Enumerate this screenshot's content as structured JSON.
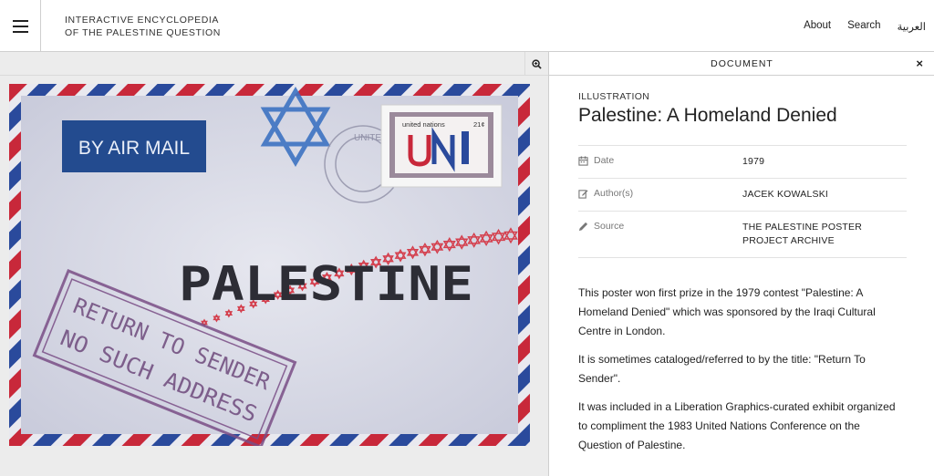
{
  "header": {
    "site_title_line1": "INTERACTIVE ENCYCLOPEDIA",
    "site_title_line2": "OF THE PALESTINE QUESTION",
    "nav": {
      "about": "About",
      "search": "Search",
      "arabic": "العربية"
    }
  },
  "viewer": {
    "zoom_icon": "zoom-in-icon",
    "poster": {
      "airmail_label": "BY AIR MAIL",
      "stamp_text": "united nations",
      "stamp_value": "21¢",
      "stamp_letters": "UN",
      "main_word": "PALESTINE",
      "stamp_line1": "RETURN TO SENDER",
      "stamp_line2": "NO SUCH ADDRESS",
      "postmark_text": "UNITED",
      "colors": {
        "red": "#c8283a",
        "blue": "#2a4a9c",
        "envelope": "#d9dbe6"
      }
    }
  },
  "document_panel": {
    "bar_title": "DOCUMENT",
    "close_label": "×",
    "kind": "ILLUSTRATION",
    "title": "Palestine: A Homeland Denied",
    "meta": [
      {
        "icon": "calendar-icon",
        "key": "Date",
        "value": "1979"
      },
      {
        "icon": "edit-icon",
        "key": "Author(s)",
        "value": "JACEK KOWALSKI"
      },
      {
        "icon": "pencil-icon",
        "key": "Source",
        "value": "THE PALESTINE POSTER PROJECT ARCHIVE"
      }
    ],
    "description": [
      "This poster won first prize in the 1979 contest \"Palestine: A Homeland Denied\" which was sponsored by the Iraqi Cultural Centre in London.",
      "It is sometimes cataloged/referred to by the title: \"Return To Sender\".",
      "It was included in a Liberation Graphics-curated exhibit organized to compliment the 1983 United Nations Conference on the Question of Palestine."
    ]
  }
}
